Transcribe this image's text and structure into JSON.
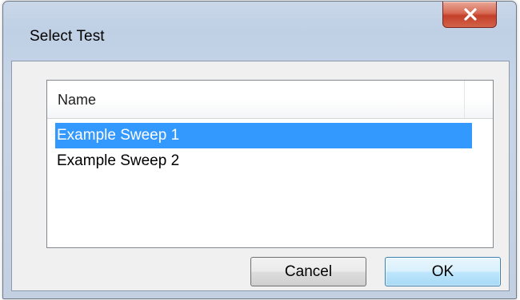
{
  "dialog": {
    "title": "Select Test",
    "close_icon": "close-icon"
  },
  "list": {
    "columns": [
      "Name"
    ],
    "items": [
      {
        "label": "Example Sweep 1",
        "selected": true
      },
      {
        "label": "Example Sweep 2",
        "selected": false
      }
    ]
  },
  "buttons": {
    "cancel_label": "Cancel",
    "ok_label": "OK"
  },
  "colors": {
    "selection": "#3399ff",
    "close_button": "#c4402a",
    "default_button": "#bee6fd"
  }
}
